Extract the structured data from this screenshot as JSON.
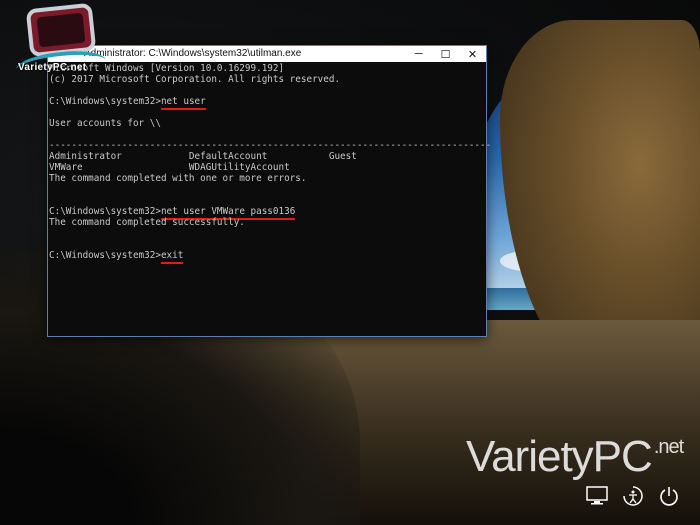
{
  "window": {
    "title": "Administrator: C:\\Windows\\system32\\utilman.exe",
    "controls": {
      "minimize": "─",
      "maximize": "☐",
      "close": "✕"
    }
  },
  "console": {
    "lines": [
      "Microsoft Windows [Version 10.0.16299.192]",
      "(c) 2017 Microsoft Corporation. All rights reserved.",
      "",
      "C:\\Windows\\system32>",
      "",
      "User accounts for \\\\",
      "",
      "-------------------------------------------------------------------------------",
      "Administrator            DefaultAccount           Guest",
      "VMWare                   WDAGUtilityAccount",
      "The command completed with one or more errors.",
      "",
      "",
      "C:\\Windows\\system32>",
      "The command completed successfully.",
      "",
      "",
      "C:\\Windows\\system32>"
    ],
    "commands": {
      "net_user": "net user",
      "net_user_set": "net user VMWare pass0136",
      "exit": "exit"
    },
    "prompt": "C:\\Windows\\system32>"
  },
  "logo_top": {
    "text": "VarietyPC.net"
  },
  "watermark": {
    "brand": "VarietyPC",
    "tld": ".net"
  },
  "tray_icons": [
    "network-icon",
    "ease-of-access-icon",
    "power-icon"
  ],
  "colors": {
    "console_bg": "#0c0c0c",
    "console_fg": "#c8c8c8",
    "underline": "#e11b1b",
    "border": "#5a7fb0"
  }
}
